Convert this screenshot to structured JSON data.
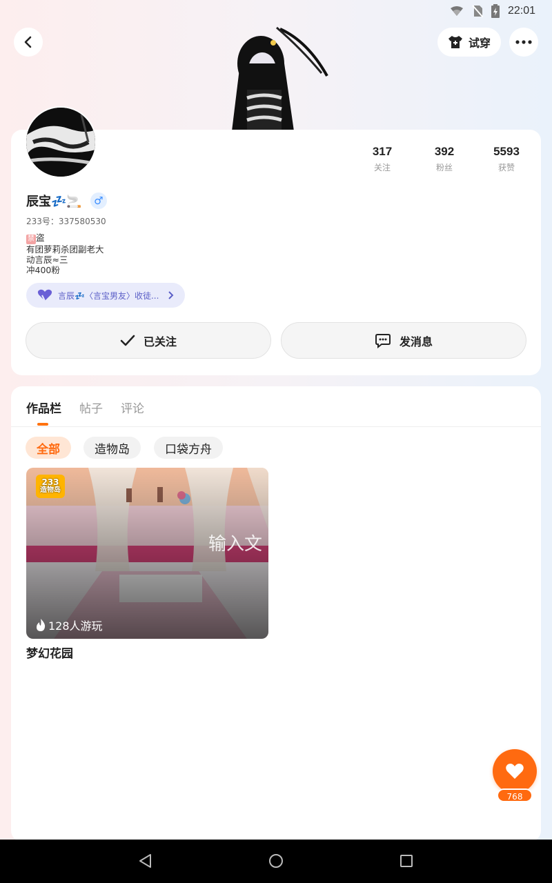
{
  "status_bar": {
    "time": "22:01"
  },
  "header": {
    "try_on_label": "试穿"
  },
  "profile": {
    "name": "辰宝💤🚬",
    "gender_symbol": "♂",
    "uid": "233号：337580530",
    "bio_tag": "禁",
    "bio_line1": "盗",
    "bio_line2": "有团萝莉杀团副老大",
    "bio_line3": "动言辰≈三",
    "bio_line4": "冲400粉",
    "relation_text": "言辰💤〈言宝男友〉收徒...",
    "stats": [
      {
        "value": "317",
        "label": "关注"
      },
      {
        "value": "392",
        "label": "粉丝"
      },
      {
        "value": "5593",
        "label": "获赞"
      }
    ],
    "follow_label": "已关注",
    "message_label": "发消息"
  },
  "tabs": [
    {
      "label": "作品栏",
      "active": true
    },
    {
      "label": "帖子",
      "active": false
    },
    {
      "label": "评论",
      "active": false
    }
  ],
  "filters": [
    {
      "label": "全部",
      "active": true
    },
    {
      "label": "造物岛",
      "active": false
    },
    {
      "label": "口袋方舟",
      "active": false
    }
  ],
  "works": [
    {
      "title": "梦幻花园",
      "play_count": "128人游玩",
      "badge_line1": "233",
      "badge_line2": "造物岛",
      "overlay_text": "输入文"
    }
  ],
  "fab": {
    "count": "768"
  },
  "colors": {
    "accent": "#ff6a10",
    "chip_bg": "#ffe6d5",
    "relation_bg": "#e9ebfb"
  }
}
